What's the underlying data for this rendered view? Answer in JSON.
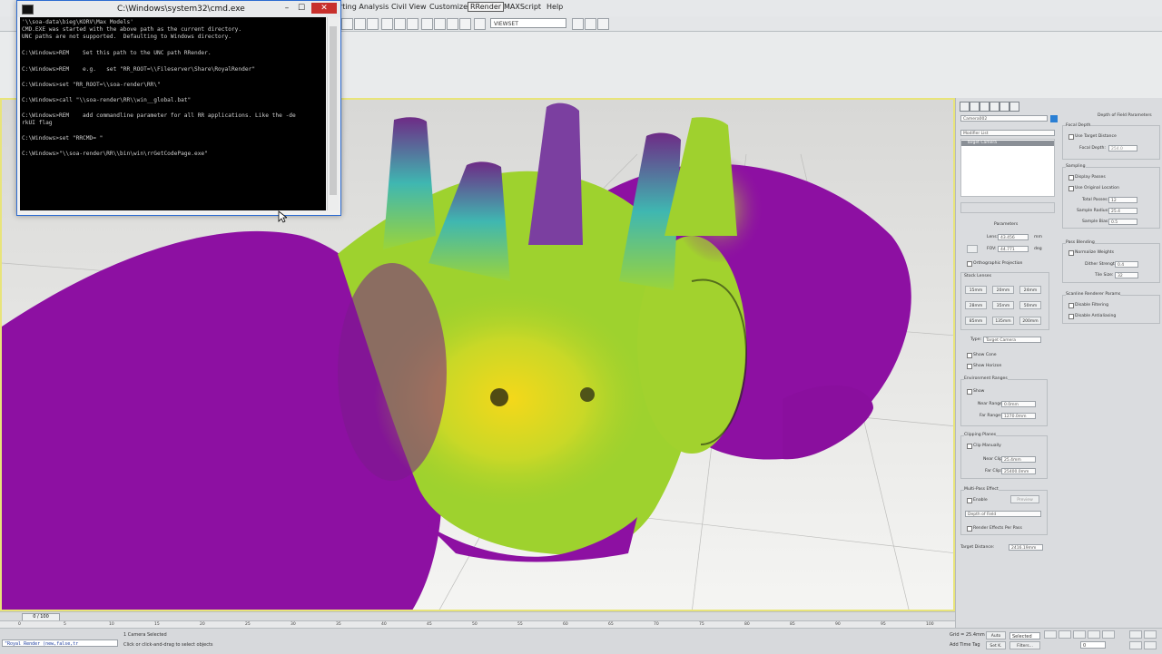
{
  "menubar": {
    "items": [
      "rting Analysis",
      "Civil View",
      "Customize",
      "RRender",
      "MAXScript",
      "Help"
    ],
    "active": "RRender"
  },
  "toolbar": {
    "viewset_label": "VIEWSET",
    "icons": [
      "select-icon",
      "move-icon",
      "rotate-icon",
      "scale-icon",
      "link-icon",
      "snap-icon"
    ]
  },
  "cmd": {
    "title": "C:\\Windows\\system32\\cmd.exe",
    "close_label": "✕",
    "min_label": "–",
    "max_label": "☐",
    "lines": [
      "'\\\\soa-data\\bieg\\KORV\\Max Models'",
      "CMD.EXE was started with the above path as the current directory.",
      "UNC paths are not supported.  Defaulting to Windows directory.",
      "",
      "C:\\Windows>REM    Set this path to the UNC path RRender.",
      "",
      "C:\\Windows>REM    e.g.   set \"RR_ROOT=\\\\Fileserver\\Share\\RoyalRender\"",
      "",
      "C:\\Windows>set \"RR_ROOT=\\\\soa-render\\RR\\\"",
      "",
      "C:\\Windows>call \"\\\\soa-render\\RR\\\\win__global.bat\"",
      "",
      "C:\\Windows>REM    add commandline parameter for all RR applications. Like the -de",
      "rkUI flag",
      "",
      "C:\\Windows>set \"RRCMD= \"",
      "",
      "C:\\Windows>\"\\\\soa-render\\RR\\\\bin\\win\\rrGetCodePage.exe\""
    ]
  },
  "panel": {
    "object_name": "Camera002",
    "modifier_list": "Modifier List",
    "stack_item": "Target Camera",
    "rollout_params": "Parameters",
    "lens_label": "Lens:",
    "lens_value": "43.456",
    "lens_unit": "mm",
    "fov_label": "FOV:",
    "fov_value": "44.771",
    "fov_unit": "deg",
    "ortho_label": "Orthographic Projection",
    "stock_lenses_label": "Stock Lenses",
    "stock_lenses": [
      "15mm",
      "20mm",
      "24mm",
      "28mm",
      "35mm",
      "50mm",
      "85mm",
      "135mm",
      "200mm"
    ],
    "type_label": "Type:",
    "type_value": "Target Camera",
    "show_cone": "Show Cone",
    "show_horizon": "Show Horizon",
    "env_ranges": "Environment Ranges",
    "env_show": "Show",
    "near_range_label": "Near Range:",
    "near_range_value": "0.0mm",
    "far_range_label": "Far Range:",
    "far_range_value": "1270.0mm",
    "clipping_planes": "Clipping Planes",
    "clip_manually": "Clip Manually",
    "near_clip_label": "Near Clip:",
    "near_clip_value": "25.4mm",
    "far_clip_label": "Far Clip:",
    "far_clip_value": "25400.0mm",
    "multipass": "Multi-Pass Effect",
    "enable_label": "Enable",
    "preview_label": "Preview",
    "effect_value": "Depth of Field",
    "render_effects": "Render Effects Per Pass",
    "target_distance_label": "Target Distance:",
    "target_distance_value": "2416.19mm",
    "dof_title": "Depth of Field Parameters",
    "focal_depth": "Focal Depth",
    "use_target_distance": "Use Target Distance",
    "focal_depth_label": "Focal Depth:",
    "focal_depth_value": "254.0",
    "sampling": "Sampling",
    "display_passes": "Display Passes",
    "use_original_location": "Use Original Location",
    "total_passes_label": "Total Passes:",
    "total_passes_value": "12",
    "sample_radius_label": "Sample Radius:",
    "sample_radius_value": "25.4",
    "sample_bias_label": "Sample Bias:",
    "sample_bias_value": "0.5",
    "pass_blending": "Pass Blending",
    "normalize_weights": "Normalize Weights",
    "dither_strength_label": "Dither Strength:",
    "dither_strength_value": "0.4",
    "tile_size_label": "Tile Size:",
    "tile_size_value": "32",
    "scanline_params": "Scanline Renderer Params",
    "disable_filtering": "Disable Filtering",
    "disable_antialiasing": "Disable Antialiasing"
  },
  "timeline": {
    "frame_label": "0 / 100",
    "ticks": [
      "0",
      "5",
      "10",
      "15",
      "20",
      "25",
      "30",
      "35",
      "40",
      "45",
      "50",
      "55",
      "60",
      "65",
      "70",
      "75",
      "80",
      "85",
      "90",
      "95",
      "100"
    ]
  },
  "status": {
    "script_field": "\"Royal Render (new,false,tr",
    "selection_text": "1 Camera Selected",
    "prompt_text": "Click or click-and-drag to select objects",
    "grid_text": "Grid = 25.4mm",
    "auto_key": "Auto",
    "set_key": "Set K.",
    "selected_value": "Selected",
    "add_time_tag": "Add Time Tag",
    "filters": "Filters...",
    "frame_value": "0"
  },
  "colors": {
    "viewport_border": "#e8e47a",
    "purple": "#8c0fa0",
    "lime": "#a8d82a",
    "yellow": "#f2d21c",
    "teal": "#3fb7b1"
  }
}
